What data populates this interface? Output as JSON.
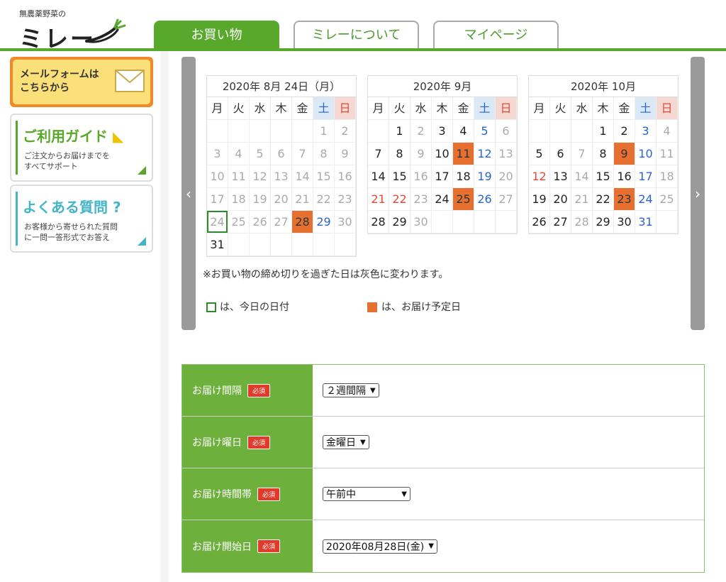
{
  "logo": {
    "top_text": "無農薬野菜の",
    "main_text": "ミレー"
  },
  "tabs": [
    "お買い物",
    "ミレーについて",
    "マイページ"
  ],
  "sidebar": {
    "mail_banner": {
      "line1": "メールフォームは",
      "line2": "こちらから"
    },
    "guide": {
      "title": "ご利用ガイド",
      "sub1": "ご注文からお届けまでを",
      "sub2": "すべてサポート"
    },
    "faq": {
      "title": "よくある質問",
      "sub1": "お客様から寄せられた質問",
      "sub2": "に一問一答形式でお答え"
    }
  },
  "calendar": {
    "weekdays": [
      "月",
      "火",
      "水",
      "木",
      "金",
      "土",
      "日"
    ],
    "months": [
      {
        "title": "2020年 8月 24日（月）",
        "days": [
          "",
          "",
          "",
          "",
          "",
          "1",
          "2",
          "3",
          "4",
          "5",
          "6",
          "7",
          "8",
          "9",
          "10",
          "11",
          "12",
          "13",
          "14",
          "15",
          "16",
          "17",
          "18",
          "19",
          "20",
          "21",
          "22",
          "23",
          "24",
          "25",
          "26",
          "27",
          "28",
          "29",
          "30",
          "31",
          "",
          "",
          "",
          "",
          "",
          ""
        ],
        "styles": [
          "",
          "",
          "",
          "",
          "",
          "past",
          "past",
          "past",
          "past",
          "past",
          "past",
          "past",
          "past",
          "past",
          "past",
          "past",
          "past",
          "past",
          "past",
          "past",
          "past",
          "past",
          "past",
          "past",
          "past",
          "past",
          "past",
          "past",
          "today",
          "past",
          "past",
          "past",
          "delivery",
          "sat",
          "past",
          "day",
          "",
          "",
          "",
          "",
          "",
          ""
        ]
      },
      {
        "title": "2020年 9月",
        "days": [
          "",
          "1",
          "2",
          "3",
          "4",
          "5",
          "6",
          "7",
          "8",
          "9",
          "10",
          "11",
          "12",
          "13",
          "14",
          "15",
          "16",
          "17",
          "18",
          "19",
          "20",
          "21",
          "22",
          "23",
          "24",
          "25",
          "26",
          "27",
          "28",
          "29",
          "30",
          "",
          "",
          "",
          ""
        ],
        "styles": [
          "",
          "day",
          "past",
          "day",
          "day",
          "sat",
          "past",
          "day",
          "day",
          "past",
          "day",
          "delivery",
          "sat",
          "past",
          "day",
          "day",
          "past",
          "day",
          "day",
          "sat",
          "past",
          "hol",
          "hol",
          "past",
          "day",
          "delivery",
          "sat",
          "past",
          "day",
          "day",
          "past",
          "",
          "",
          "",
          ""
        ]
      },
      {
        "title": "2020年 10月",
        "days": [
          "",
          "",
          "",
          "1",
          "2",
          "3",
          "4",
          "5",
          "6",
          "7",
          "8",
          "9",
          "10",
          "11",
          "12",
          "13",
          "14",
          "15",
          "16",
          "17",
          "18",
          "19",
          "20",
          "21",
          "22",
          "23",
          "24",
          "25",
          "26",
          "27",
          "28",
          "29",
          "30",
          "31",
          ""
        ],
        "styles": [
          "",
          "",
          "",
          "day",
          "day",
          "sat",
          "past",
          "day",
          "day",
          "past",
          "day",
          "delivery",
          "sat",
          "past",
          "hol",
          "day",
          "past",
          "day",
          "day",
          "sat",
          "past",
          "day",
          "day",
          "past",
          "day",
          "delivery",
          "sat",
          "past",
          "day",
          "day",
          "past",
          "day",
          "day",
          "sat",
          ""
        ]
      }
    ],
    "note": "※お買い物の締め切りを過ぎた日は灰色に変わります。",
    "legend_today": "は、今日の日付",
    "legend_delivery": "は、お届け予定日"
  },
  "form": {
    "required_label": "必須",
    "rows": [
      {
        "label": "お届け間隔",
        "value": "２週間隔"
      },
      {
        "label": "お届け曜日",
        "value": "金曜日"
      },
      {
        "label": "お届け時間帯",
        "value": "午前中"
      },
      {
        "label": "お届け開始日",
        "value": "2020年08月28日(金)"
      }
    ]
  },
  "colors": {
    "brand_green": "#58a82b",
    "delivery_orange": "#e5702f",
    "saturday_blue": "#2a63c9",
    "sunday_red": "#e04a3a"
  }
}
